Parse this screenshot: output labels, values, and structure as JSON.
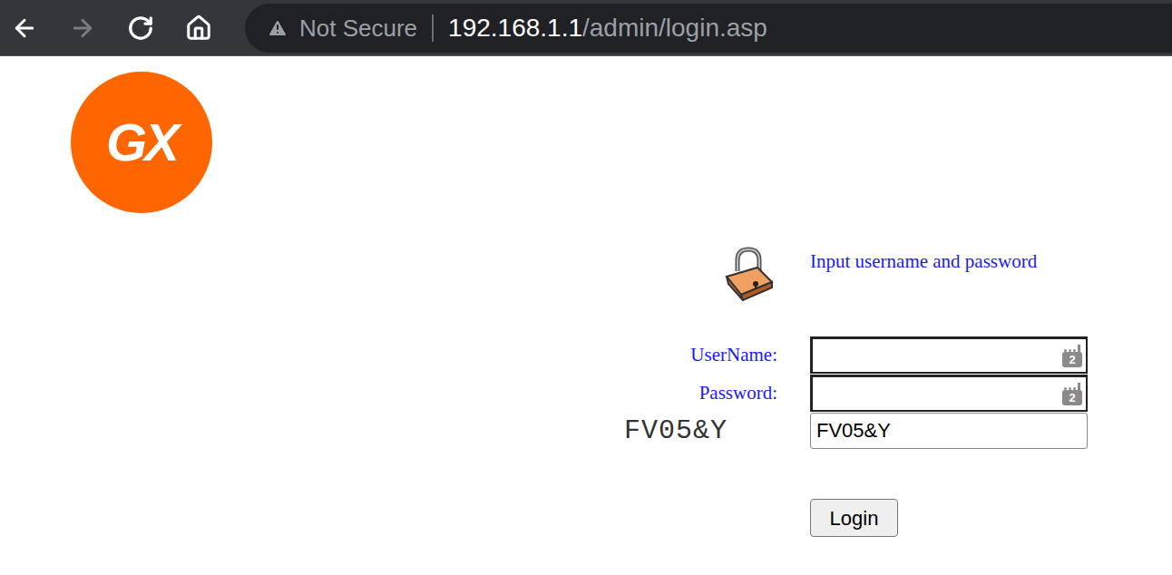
{
  "browser": {
    "nav": [
      {
        "kind": "back",
        "disabled": false
      },
      {
        "kind": "forward",
        "disabled": true
      },
      {
        "kind": "reload",
        "disabled": false
      },
      {
        "kind": "home",
        "disabled": false
      }
    ],
    "security": "Not Secure",
    "url": {
      "host": "192.168.1.1",
      "path": "/admin/login.asp"
    }
  },
  "logo": {
    "text": "GX"
  },
  "form": {
    "heading": "Input username and password",
    "fields": [
      {
        "label": "UserName:",
        "kind": "text",
        "value": "",
        "badge": "2"
      },
      {
        "label": "Password:",
        "kind": "password",
        "value": "",
        "badge": "2"
      },
      {
        "label": "FV05&Y",
        "kind": "captcha",
        "value": "FV05&Y"
      }
    ],
    "button": "Login"
  }
}
